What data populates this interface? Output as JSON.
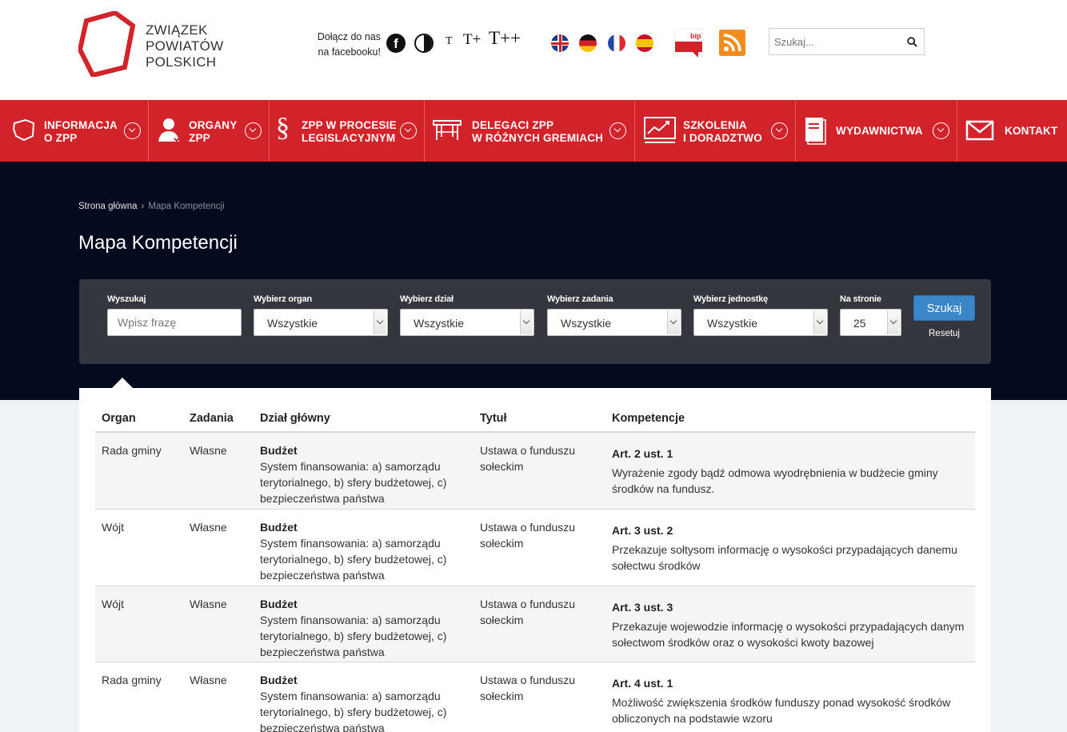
{
  "header": {
    "logo": {
      "line1": "ZWIĄZEK",
      "line2": "POWIATÓW",
      "line3": "POLSKICH"
    },
    "facebook_text_1": "Dołącz do nas",
    "facebook_text_2": "na facebooku!",
    "font_sizes": [
      "T",
      "T+",
      "T++"
    ],
    "languages": [
      "en-flag-icon",
      "de-flag-icon",
      "fr-flag-icon",
      "es-flag-icon"
    ],
    "bip_label": "bip",
    "search_placeholder": "Szukaj..."
  },
  "nav": {
    "items": [
      {
        "line1": "INFORMACJA",
        "line2": "O ZPP",
        "icon": "poland-map-icon"
      },
      {
        "line1": "ORGANY",
        "line2": "ZPP",
        "icon": "user-icon"
      },
      {
        "line1": "ZPP W PROCESIE",
        "line2": "LEGISLACYJNYM",
        "icon": "paragraph-icon"
      },
      {
        "line1": "DELEGACI ZPP",
        "line2": "W RÓŻNYCH GREMIACH",
        "icon": "table-icon"
      },
      {
        "line1": "SZKOLENIA",
        "line2": "I DORADZTWO",
        "icon": "chart-board-icon"
      },
      {
        "line1": "WYDAWNICTWA",
        "line2": "",
        "icon": "book-icon"
      },
      {
        "line1": "KONTAKT",
        "line2": "",
        "icon": "envelope-icon"
      }
    ]
  },
  "breadcrumb": {
    "home": "Strona główna",
    "separator": "›",
    "current": "Mapa Kompetencji"
  },
  "page_title": "Mapa Kompetencji",
  "filters": {
    "search": {
      "label": "Wyszukaj",
      "placeholder": "Wpisz frazę"
    },
    "organ": {
      "label": "Wybierz organ",
      "value": "Wszystkie"
    },
    "dzial": {
      "label": "Wybierz dział",
      "value": "Wszystkie"
    },
    "zadania": {
      "label": "Wybierz zadania",
      "value": "Wszystkie"
    },
    "jednostka": {
      "label": "Wybierz jednostkę",
      "value": "Wszystkie"
    },
    "per_page": {
      "label": "Na stronie",
      "value": "25"
    },
    "submit_label": "Szukaj",
    "reset_label": "Resetuj"
  },
  "table": {
    "headers": {
      "organ": "Organ",
      "zadania": "Zadania",
      "dzial": "Dział główny",
      "tytul": "Tytuł",
      "kompetencje": "Kompetencje"
    },
    "rows": [
      {
        "organ": "Rada gminy",
        "zadania": "Własne",
        "dzial_title": "Budżet",
        "dzial_desc": "System finansowania: a) samorządu terytorialnego, b) sfery budżetowej, c) bezpieczeństwa państwa",
        "tytul": "Ustawa o funduszu sołeckim",
        "komp_title": "Art. 2 ust. 1",
        "komp_desc": "Wyrażenie zgody bądź odmowa wyodrębnienia w budżecie gminy środków na fundusz."
      },
      {
        "organ": "Wójt",
        "zadania": "Własne",
        "dzial_title": "Budżet",
        "dzial_desc": "System finansowania: a) samorządu terytorialnego, b) sfery budżetowej, c) bezpieczeństwa państwa",
        "tytul": "Ustawa o funduszu sołeckim",
        "komp_title": "Art. 3 ust. 2",
        "komp_desc": "Przekazuje sołtysom informację o wysokości przypadających danemu sołectwu środków"
      },
      {
        "organ": "Wójt",
        "zadania": "Własne",
        "dzial_title": "Budżet",
        "dzial_desc": "System finansowania: a) samorządu terytorialnego, b) sfery budżetowej, c) bezpieczeństwa państwa",
        "tytul": "Ustawa o funduszu sołeckim",
        "komp_title": "Art. 3 ust. 3",
        "komp_desc": "Przekazuje wojewodzie informację o wysokości przypadających danym sołectwom środków oraz o wysokości kwoty bazowej"
      },
      {
        "organ": "Rada gminy",
        "zadania": "Własne",
        "dzial_title": "Budżet",
        "dzial_desc": "System finansowania: a) samorządu terytorialnego, b) sfery budżetowej, c) bezpieczeństwa państwa",
        "tytul": "Ustawa o funduszu sołeckim",
        "komp_title": "Art. 4 ust. 1",
        "komp_desc": "Możliwość zwiększenia środków funduszy ponad wysokość środków obliczonych na podstawie wzoru"
      }
    ]
  },
  "colors": {
    "brand_red": "#d2232a",
    "dark_band": "#050b1e",
    "panel": "#33363c",
    "button_blue": "#3a86c8"
  }
}
